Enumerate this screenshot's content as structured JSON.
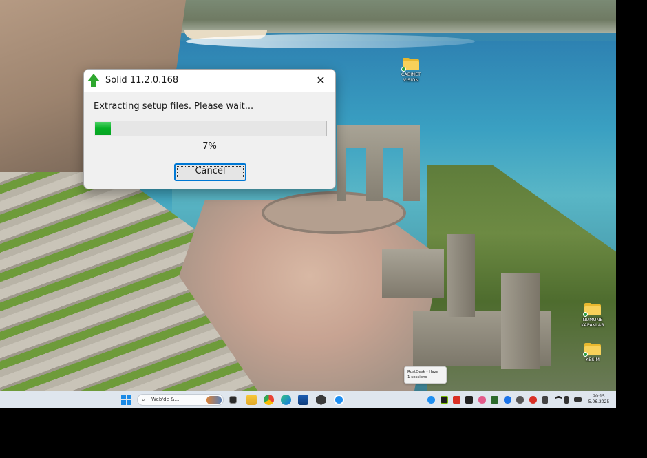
{
  "dialog": {
    "title": "Solid 11.2.0.168",
    "message": "Extracting setup files. Please wait...",
    "progress_fraction": 0.07,
    "progress_text": "7%",
    "cancel_label": "Cancel",
    "close_glyph": "✕",
    "icon": "green-up-arrow-icon",
    "accent_color": "#06b025"
  },
  "desktop": {
    "icons": [
      {
        "label_line1": "CABINET",
        "label_line2": "VISION",
        "icon": "folder-icon"
      },
      {
        "label_line1": "NUMUNE",
        "label_line2": "KAPAKLAR",
        "icon": "folder-icon"
      },
      {
        "label_line1": "KESIM",
        "label_line2": "",
        "icon": "folder-icon"
      }
    ],
    "tooltip": {
      "line1": "RustDesk - Hazır",
      "line2": "1 sessions"
    }
  },
  "taskbar": {
    "search_placeholder": "Web'de &...",
    "clock_time": "20:15",
    "clock_date": "5.06.2025",
    "pinned": [
      "start-icon",
      "task-view-icon",
      "file-explorer-icon",
      "chrome-icon",
      "edge-icon",
      "store-icon",
      "app-icon",
      "rustdesk-icon"
    ],
    "tray": [
      "rustdesk-tray-icon",
      "nvidia-icon",
      "app-tray-icon",
      "security-icon",
      "audio-wave-icon",
      "display-icon",
      "bluetooth-icon",
      "cloud-icon",
      "defender-icon",
      "usb-icon",
      "wifi-icon",
      "volume-icon",
      "battery-icon"
    ]
  }
}
